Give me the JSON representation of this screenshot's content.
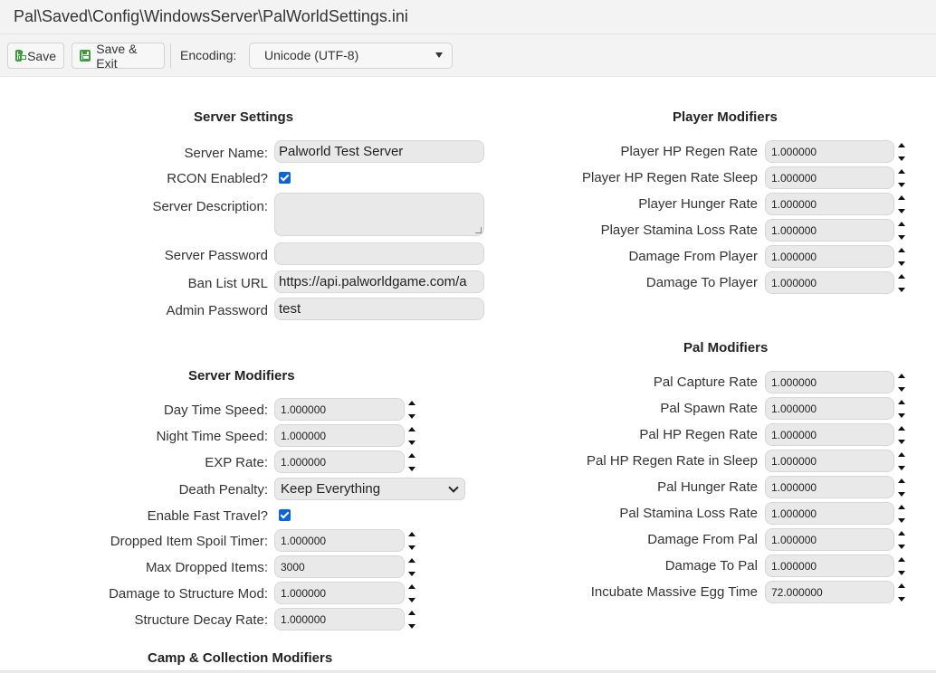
{
  "title": "Pal\\Saved\\Config\\WindowsServer\\PalWorldSettings.ini",
  "toolbar": {
    "save": "Save",
    "save_exit": "Save & Exit",
    "encoding_label": "Encoding:",
    "encoding_value": "Unicode (UTF-8)"
  },
  "server_settings": {
    "heading": "Server Settings",
    "server_name": {
      "label": "Server Name:",
      "value": "Palworld Test Server"
    },
    "rcon": {
      "label": "RCON Enabled?",
      "checked": true
    },
    "description": {
      "label": "Server Description:",
      "value": ""
    },
    "password": {
      "label": "Server Password",
      "value": ""
    },
    "ban_list": {
      "label": "Ban List URL",
      "value": "https://api.palworldgame.com/a"
    },
    "admin_password": {
      "label": "Admin Password",
      "value": "test"
    }
  },
  "server_modifiers": {
    "heading": "Server Modifiers",
    "day_speed": {
      "label": "Day Time Speed:",
      "value": "1.000000"
    },
    "night_speed": {
      "label": "Night Time Speed:",
      "value": "1.000000"
    },
    "exp_rate": {
      "label": "EXP Rate:",
      "value": "1.000000"
    },
    "death_penalty": {
      "label": "Death Penalty:",
      "value": "Keep Everything"
    },
    "fast_travel": {
      "label": "Enable Fast Travel?",
      "checked": true
    },
    "spoil_timer": {
      "label": "Dropped Item Spoil Timer:",
      "value": "1.000000"
    },
    "max_dropped": {
      "label": "Max Dropped Items:",
      "value": "3000"
    },
    "structure_dmg": {
      "label": "Damage to Structure Mod:",
      "value": "1.000000"
    },
    "decay_rate": {
      "label": "Structure Decay Rate:",
      "value": "1.000000"
    }
  },
  "camp_heading": "Camp & Collection Modifiers",
  "player_modifiers": {
    "heading": "Player Modifiers",
    "rows": [
      {
        "label": "Player HP Regen Rate",
        "value": "1.000000"
      },
      {
        "label": "Player HP Regen Rate Sleep",
        "value": "1.000000"
      },
      {
        "label": "Player Hunger Rate",
        "value": "1.000000"
      },
      {
        "label": "Player Stamina Loss Rate",
        "value": "1.000000"
      },
      {
        "label": "Damage From Player",
        "value": "1.000000"
      },
      {
        "label": "Damage To Player",
        "value": "1.000000"
      }
    ]
  },
  "pal_modifiers": {
    "heading": "Pal Modifiers",
    "rows": [
      {
        "label": "Pal Capture Rate",
        "value": "1.000000"
      },
      {
        "label": "Pal Spawn Rate",
        "value": "1.000000"
      },
      {
        "label": "Pal HP Regen Rate",
        "value": "1.000000"
      },
      {
        "label": "Pal HP Regen Rate in Sleep",
        "value": "1.000000"
      },
      {
        "label": "Pal Hunger Rate",
        "value": "1.000000"
      },
      {
        "label": "Pal Stamina Loss Rate",
        "value": "1.000000"
      },
      {
        "label": "Damage From Pal",
        "value": "1.000000"
      },
      {
        "label": "Damage To Pal",
        "value": "1.000000"
      },
      {
        "label": "Incubate Massive Egg Time",
        "value": "72.000000"
      }
    ]
  }
}
